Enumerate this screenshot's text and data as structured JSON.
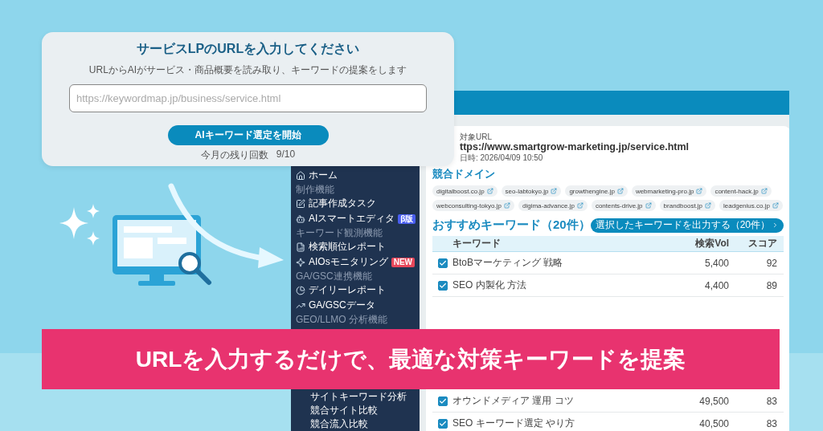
{
  "url_card": {
    "title": "サービスLPのURLを入力してください",
    "subtitle": "URLからAIがサービス・商品概要を読み取り、キーワードの提案をします",
    "input": {
      "placeholder": "https://keywordmap.jp/business/service.html"
    },
    "button": "AIキーワード選定を開始",
    "remaining_label": "今月の残り回数",
    "remaining_value": "9/10"
  },
  "sidebar": {
    "items": [
      {
        "kind": "item",
        "label": "ホーム"
      },
      {
        "kind": "section",
        "label": "制作機能"
      },
      {
        "kind": "item",
        "label": "記事作成タスク"
      },
      {
        "kind": "item",
        "label": "AIスマートエディタ",
        "badge": {
          "text": "β版",
          "color": "#4a5ff0"
        }
      },
      {
        "kind": "section",
        "label": "キーワード観測機能"
      },
      {
        "kind": "item",
        "label": "検索順位レポート"
      },
      {
        "kind": "item",
        "label": "AIOsモニタリング",
        "badge": {
          "text": "NEW",
          "color": "#e8475a"
        }
      },
      {
        "kind": "section",
        "label": "GA/GSC連携機能"
      },
      {
        "kind": "item",
        "label": "デイリーレポート"
      },
      {
        "kind": "item",
        "label": "GA/GSCデータ"
      },
      {
        "kind": "section",
        "label": "GEO/LLMO 分析機能"
      }
    ],
    "bottom_items": [
      {
        "kind": "subitem",
        "label": "サイトキーワード分析"
      },
      {
        "kind": "subitem",
        "label": "競合サイト比較"
      },
      {
        "kind": "subitem",
        "label": "競合流入比較"
      }
    ]
  },
  "result": {
    "url_label": "対象URL",
    "url": "ttps://www.smartgrow-marketing.jp/service.html",
    "date": "日時: 2026/04/09 10:50",
    "domains_title": "競合ドメイン",
    "domains": [
      "digitalboost.co.jp",
      "seo-labtokyo.jp",
      "growthengine.jp",
      "webmarketing-pro.jp",
      "content-hack.jp",
      "webconsulting-tokyo.jp",
      "digima-advance.jp",
      "contents-drive.jp",
      "brandboost.jp",
      "leadgenius.co.jp"
    ],
    "keywords_title": "おすすめキーワード（20件）",
    "export_button": "選択したキーワードを出力する（20件）",
    "table": {
      "columns": [
        "キーワード",
        "検索Vol",
        "スコア"
      ],
      "rows": [
        {
          "checked": true,
          "keyword": "BtoBマーケティング 戦略",
          "volume": "5,400",
          "score": "92"
        },
        {
          "checked": true,
          "keyword": "SEO 内製化 方法",
          "volume": "4,400",
          "score": "89"
        }
      ],
      "rows_lower": [
        {
          "checked": true,
          "keyword": "オウンドメディア 運用 コツ",
          "volume": "49,500",
          "score": "83"
        },
        {
          "checked": true,
          "keyword": "SEO キーワード選定 やり方",
          "volume": "40,500",
          "score": "83"
        }
      ]
    }
  },
  "banner": {
    "text": "URLを入力するだけで、最適な対策キーワードを提案"
  }
}
